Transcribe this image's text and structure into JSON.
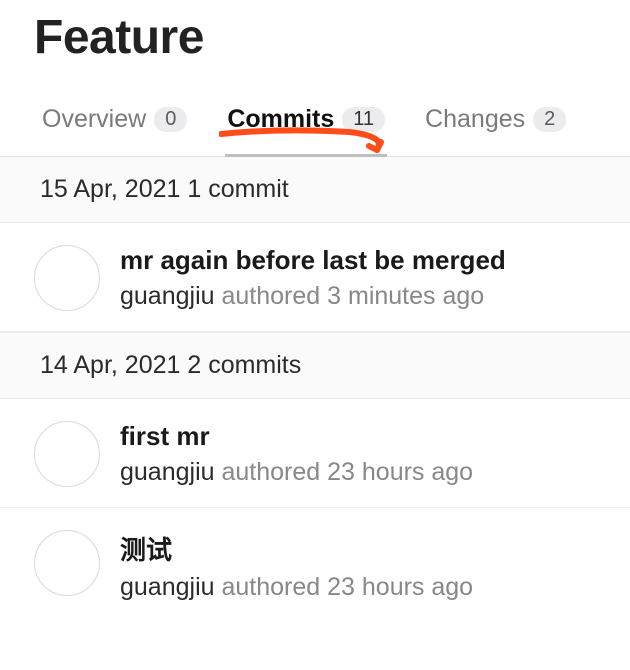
{
  "title": "Feature",
  "tabs": [
    {
      "label": "Overview",
      "count": "0",
      "active": false
    },
    {
      "label": "Commits",
      "count": "11",
      "active": true
    },
    {
      "label": "Changes",
      "count": "2",
      "active": false
    }
  ],
  "groups": [
    {
      "header": "15 Apr, 2021 1 commit",
      "commits": [
        {
          "title": "mr again before last be merged",
          "author": "guangjiu",
          "action": "authored",
          "time": "3 minutes ago"
        }
      ]
    },
    {
      "header": "14 Apr, 2021 2 commits",
      "commits": [
        {
          "title": "first mr",
          "author": "guangjiu",
          "action": "authored",
          "time": "23 hours ago"
        },
        {
          "title": "测试",
          "author": "guangjiu",
          "action": "authored",
          "time": "23 hours ago"
        }
      ]
    }
  ]
}
